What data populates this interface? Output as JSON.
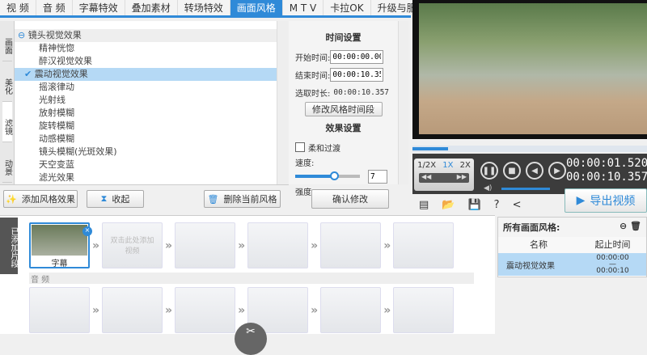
{
  "tabs": [
    "视 频",
    "音 频",
    "字幕特效",
    "叠加素材",
    "转场特效",
    "画面风格",
    "M T V",
    "卡拉OK",
    "升级与服务"
  ],
  "active_tab": "画面风格",
  "side_tabs": [
    "画面",
    "美化",
    "滤镜",
    "动景"
  ],
  "effect_list": {
    "group": "镜头视觉效果",
    "items": [
      "精神恍惚",
      "醉汉视觉效果",
      "震动视觉效果",
      "摇滚律动",
      "光射线",
      "放射模糊",
      "旋转模糊",
      "动感模糊",
      "镜头模糊(光斑效果)",
      "天空变蓝",
      "滤光效果"
    ],
    "selected": "震动视觉效果"
  },
  "buttons": {
    "add": "添加风格效果",
    "collapse": "收起",
    "delete": "删除当前风格",
    "confirm": "确认修改",
    "modify_time": "修改风格时间段"
  },
  "time_settings": {
    "title": "时间设置",
    "start_label": "开始时间:",
    "start": "00:00:00.000",
    "end_label": "结束时间:",
    "end": "00:00:10.357",
    "duration_label": "选取时长:",
    "duration": "00:00:10.357"
  },
  "effect_settings": {
    "title": "效果设置",
    "soft_label": "柔和过渡",
    "speed_label": "速度:",
    "speed": "7",
    "speed_fraction": 0.6,
    "strength_label": "强度:"
  },
  "player": {
    "speeds": [
      "1/2X",
      "1X",
      "2X"
    ],
    "current_time": "00:00:01.520",
    "total_time": "00:00:10.357",
    "progress": 0.15,
    "volume": 1.0,
    "export": "导出视频"
  },
  "timeline": {
    "side_label": "已添加片段",
    "clip_label": "字幕",
    "empty_hint": "双击此处添加视频",
    "audio_label": "音 频"
  },
  "styles_panel": {
    "title": "所有画面风格:",
    "col_name": "名称",
    "col_time": "起止时间",
    "rows": [
      {
        "name": "震动视觉效果",
        "start": "00:00:00",
        "dash": "—",
        "end": "00:00:10"
      }
    ]
  },
  "colors": {
    "accent": "#2f8ad8",
    "selected": "#b5d9f5"
  }
}
